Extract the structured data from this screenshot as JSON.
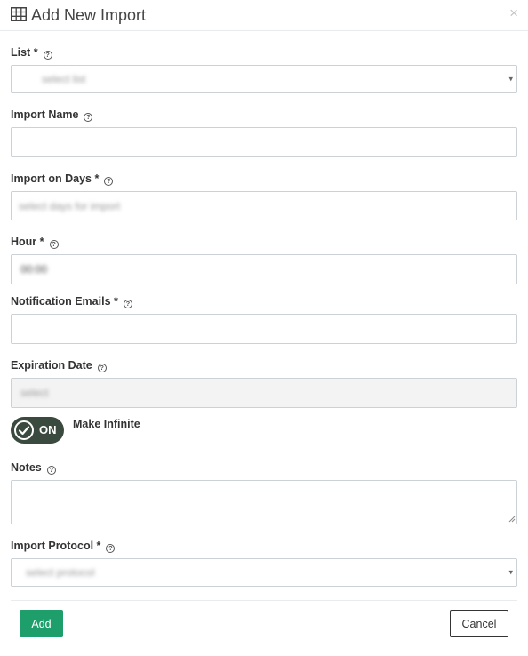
{
  "header": {
    "title": "Add New Import",
    "title_icon": "table-icon",
    "close_icon": "close-icon",
    "close_glyph": "×"
  },
  "help_glyph": "?",
  "fields": {
    "list": {
      "label": "List *",
      "placeholder": "select list"
    },
    "import_name": {
      "label": "Import Name",
      "value": ""
    },
    "import_days": {
      "label": "Import on Days *",
      "placeholder": "select days for import"
    },
    "hour": {
      "label": "Hour *",
      "value": "00:00"
    },
    "notification_emails": {
      "label": "Notification Emails *",
      "value": ""
    },
    "expiration_date": {
      "label": "Expiration Date",
      "placeholder": "select"
    },
    "make_infinite": {
      "toggle_text": "ON",
      "label": "Make Infinite",
      "state": true
    },
    "notes": {
      "label": "Notes",
      "value": ""
    },
    "import_protocol": {
      "label": "Import Protocol *",
      "placeholder": "select protocol"
    }
  },
  "caret_glyph": "▾",
  "footer": {
    "add_label": "Add",
    "cancel_label": "Cancel"
  },
  "colors": {
    "primary": "#1e9e6a",
    "toggle_bg": "#3a4a3e"
  }
}
